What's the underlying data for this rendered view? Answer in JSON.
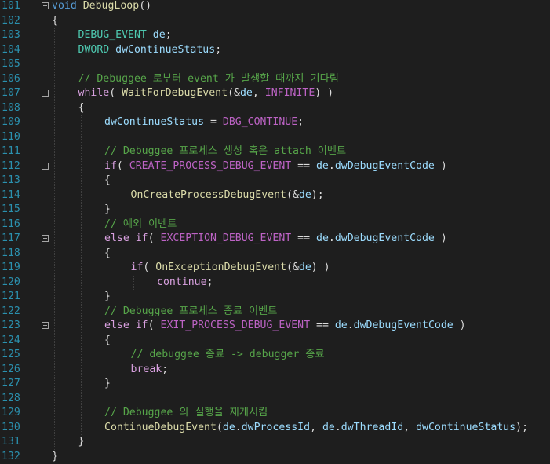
{
  "editor": {
    "lines": [
      {
        "num": "101",
        "fold": true,
        "indent": 0,
        "tokens": [
          {
            "t": "void",
            "c": "kw"
          },
          {
            "t": " ",
            "c": "pl"
          },
          {
            "t": "DebugLoop",
            "c": "fn"
          },
          {
            "t": "()",
            "c": "pl"
          }
        ]
      },
      {
        "num": "102",
        "indent": 0,
        "tokens": [
          {
            "t": "{",
            "c": "pl"
          }
        ]
      },
      {
        "num": "103",
        "indent": 1,
        "tokens": [
          {
            "t": "DEBUG_EVENT",
            "c": "ty"
          },
          {
            "t": " ",
            "c": "pl"
          },
          {
            "t": "de",
            "c": "var"
          },
          {
            "t": ";",
            "c": "pl"
          }
        ]
      },
      {
        "num": "104",
        "indent": 1,
        "tokens": [
          {
            "t": "DWORD",
            "c": "ty"
          },
          {
            "t": " ",
            "c": "pl"
          },
          {
            "t": "dwContinueStatus",
            "c": "var"
          },
          {
            "t": ";",
            "c": "pl"
          }
        ]
      },
      {
        "num": "105",
        "indent": 0,
        "tokens": []
      },
      {
        "num": "106",
        "indent": 1,
        "tokens": [
          {
            "t": "// Debuggee 로부터 event 가 발생할 때까지 기다림",
            "c": "cm"
          }
        ]
      },
      {
        "num": "107",
        "fold": true,
        "indent": 1,
        "tokens": [
          {
            "t": "while",
            "c": "kw2"
          },
          {
            "t": "( ",
            "c": "pl"
          },
          {
            "t": "WaitForDebugEvent",
            "c": "fn"
          },
          {
            "t": "(&",
            "c": "pl"
          },
          {
            "t": "de",
            "c": "var"
          },
          {
            "t": ", ",
            "c": "pl"
          },
          {
            "t": "INFINITE",
            "c": "mac"
          },
          {
            "t": ") )",
            "c": "pl"
          }
        ]
      },
      {
        "num": "108",
        "indent": 1,
        "tokens": [
          {
            "t": "{",
            "c": "pl"
          }
        ]
      },
      {
        "num": "109",
        "indent": 2,
        "tokens": [
          {
            "t": "dwContinueStatus",
            "c": "var"
          },
          {
            "t": " = ",
            "c": "pl"
          },
          {
            "t": "DBG_CONTINUE",
            "c": "mac"
          },
          {
            "t": ";",
            "c": "pl"
          }
        ]
      },
      {
        "num": "110",
        "indent": 0,
        "tokens": []
      },
      {
        "num": "111",
        "indent": 2,
        "tokens": [
          {
            "t": "// Debuggee 프로세스 생성 혹은 attach 이벤트",
            "c": "cm"
          }
        ]
      },
      {
        "num": "112",
        "fold": true,
        "indent": 2,
        "tokens": [
          {
            "t": "if",
            "c": "kw2"
          },
          {
            "t": "( ",
            "c": "pl"
          },
          {
            "t": "CREATE_PROCESS_DEBUG_EVENT",
            "c": "mac"
          },
          {
            "t": " == ",
            "c": "pl"
          },
          {
            "t": "de",
            "c": "var"
          },
          {
            "t": ".",
            "c": "pl"
          },
          {
            "t": "dwDebugEventCode",
            "c": "var"
          },
          {
            "t": " )",
            "c": "pl"
          }
        ]
      },
      {
        "num": "113",
        "indent": 2,
        "tokens": [
          {
            "t": "{",
            "c": "pl"
          }
        ]
      },
      {
        "num": "114",
        "indent": 3,
        "tokens": [
          {
            "t": "OnCreateProcessDebugEvent",
            "c": "fn"
          },
          {
            "t": "(&",
            "c": "pl"
          },
          {
            "t": "de",
            "c": "var"
          },
          {
            "t": ");",
            "c": "pl"
          }
        ]
      },
      {
        "num": "115",
        "indent": 2,
        "tokens": [
          {
            "t": "}",
            "c": "pl"
          }
        ]
      },
      {
        "num": "116",
        "indent": 2,
        "tokens": [
          {
            "t": "// 예외 이벤트",
            "c": "cm"
          }
        ]
      },
      {
        "num": "117",
        "fold": true,
        "indent": 2,
        "tokens": [
          {
            "t": "else",
            "c": "kw2"
          },
          {
            "t": " ",
            "c": "pl"
          },
          {
            "t": "if",
            "c": "kw2"
          },
          {
            "t": "( ",
            "c": "pl"
          },
          {
            "t": "EXCEPTION_DEBUG_EVENT",
            "c": "mac"
          },
          {
            "t": " == ",
            "c": "pl"
          },
          {
            "t": "de",
            "c": "var"
          },
          {
            "t": ".",
            "c": "pl"
          },
          {
            "t": "dwDebugEventCode",
            "c": "var"
          },
          {
            "t": " )",
            "c": "pl"
          }
        ]
      },
      {
        "num": "118",
        "indent": 2,
        "tokens": [
          {
            "t": "{",
            "c": "pl"
          }
        ]
      },
      {
        "num": "119",
        "indent": 3,
        "tokens": [
          {
            "t": "if",
            "c": "kw2"
          },
          {
            "t": "( ",
            "c": "pl"
          },
          {
            "t": "OnExceptionDebugEvent",
            "c": "fn"
          },
          {
            "t": "(&",
            "c": "pl"
          },
          {
            "t": "de",
            "c": "var"
          },
          {
            "t": ") )",
            "c": "pl"
          }
        ]
      },
      {
        "num": "120",
        "indent": 4,
        "tokens": [
          {
            "t": "continue",
            "c": "kw2"
          },
          {
            "t": ";",
            "c": "pl"
          }
        ]
      },
      {
        "num": "121",
        "indent": 2,
        "tokens": [
          {
            "t": "}",
            "c": "pl"
          }
        ]
      },
      {
        "num": "122",
        "indent": 2,
        "tokens": [
          {
            "t": "// Debuggee 프로세스 종료 이벤트",
            "c": "cm"
          }
        ]
      },
      {
        "num": "123",
        "fold": true,
        "indent": 2,
        "tokens": [
          {
            "t": "else",
            "c": "kw2"
          },
          {
            "t": " ",
            "c": "pl"
          },
          {
            "t": "if",
            "c": "kw2"
          },
          {
            "t": "( ",
            "c": "pl"
          },
          {
            "t": "EXIT_PROCESS_DEBUG_EVENT",
            "c": "mac"
          },
          {
            "t": " == ",
            "c": "pl"
          },
          {
            "t": "de",
            "c": "var"
          },
          {
            "t": ".",
            "c": "pl"
          },
          {
            "t": "dwDebugEventCode",
            "c": "var"
          },
          {
            "t": " )",
            "c": "pl"
          }
        ]
      },
      {
        "num": "124",
        "indent": 2,
        "tokens": [
          {
            "t": "{",
            "c": "pl"
          }
        ]
      },
      {
        "num": "125",
        "indent": 3,
        "tokens": [
          {
            "t": "// debuggee 종료 -> debugger 종료",
            "c": "cm"
          }
        ]
      },
      {
        "num": "126",
        "indent": 3,
        "tokens": [
          {
            "t": "break",
            "c": "kw2"
          },
          {
            "t": ";",
            "c": "pl"
          }
        ]
      },
      {
        "num": "127",
        "indent": 2,
        "tokens": [
          {
            "t": "}",
            "c": "pl"
          }
        ]
      },
      {
        "num": "128",
        "indent": 0,
        "tokens": []
      },
      {
        "num": "129",
        "indent": 2,
        "tokens": [
          {
            "t": "// Debuggee 의 실행을 재개시킴",
            "c": "cm"
          }
        ]
      },
      {
        "num": "130",
        "indent": 2,
        "tokens": [
          {
            "t": "ContinueDebugEvent",
            "c": "fn"
          },
          {
            "t": "(",
            "c": "pl"
          },
          {
            "t": "de",
            "c": "var"
          },
          {
            "t": ".",
            "c": "pl"
          },
          {
            "t": "dwProcessId",
            "c": "var"
          },
          {
            "t": ", ",
            "c": "pl"
          },
          {
            "t": "de",
            "c": "var"
          },
          {
            "t": ".",
            "c": "pl"
          },
          {
            "t": "dwThreadId",
            "c": "var"
          },
          {
            "t": ", ",
            "c": "pl"
          },
          {
            "t": "dwContinueStatus",
            "c": "var"
          },
          {
            "t": ");",
            "c": "pl"
          }
        ]
      },
      {
        "num": "131",
        "indent": 1,
        "tokens": [
          {
            "t": "}",
            "c": "pl"
          }
        ]
      },
      {
        "num": "132",
        "indent": 0,
        "tokens": [
          {
            "t": "}",
            "c": "pl"
          }
        ]
      }
    ]
  }
}
